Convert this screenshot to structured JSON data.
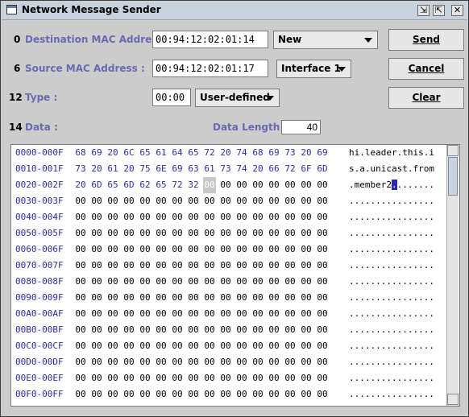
{
  "window": {
    "title": "Network Message Sender"
  },
  "fields": {
    "dest": {
      "num": "0",
      "label": "Destination MAC Address :",
      "value": "00:94:12:02:01:14",
      "combo": "New"
    },
    "src": {
      "num": "6",
      "label": "Source MAC Address :",
      "value": "00:94:12:02:01:17",
      "combo": "Interface 1"
    },
    "type": {
      "num": "12",
      "label": "Type :",
      "value": "00:00",
      "combo": "User-defined"
    },
    "data": {
      "num": "14",
      "label": "Data :",
      "length_label": "Data Length :",
      "length_value": "40"
    }
  },
  "buttons": {
    "send": "Send",
    "cancel": "Cancel",
    "clear": "Clear"
  },
  "hex": {
    "rows": [
      {
        "offset": "0000-000F",
        "bytes": [
          "68",
          "69",
          "20",
          "6C",
          "65",
          "61",
          "64",
          "65",
          "72",
          "20",
          "74",
          "68",
          "69",
          "73",
          "20",
          "69"
        ],
        "ascii": "hi.leader.this.i"
      },
      {
        "offset": "0010-001F",
        "bytes": [
          "73",
          "20",
          "61",
          "20",
          "75",
          "6E",
          "69",
          "63",
          "61",
          "73",
          "74",
          "20",
          "66",
          "72",
          "6F",
          "6D"
        ],
        "ascii": "s.a.unicast.from"
      },
      {
        "offset": "0020-002F",
        "bytes": [
          "20",
          "6D",
          "65",
          "6D",
          "62",
          "65",
          "72",
          "32",
          "00",
          "00",
          "00",
          "00",
          "00",
          "00",
          "00",
          "00"
        ],
        "ascii": ".member2........"
      },
      {
        "offset": "0030-003F",
        "bytes": [
          "00",
          "00",
          "00",
          "00",
          "00",
          "00",
          "00",
          "00",
          "00",
          "00",
          "00",
          "00",
          "00",
          "00",
          "00",
          "00"
        ],
        "ascii": "................"
      },
      {
        "offset": "0040-004F",
        "bytes": [
          "00",
          "00",
          "00",
          "00",
          "00",
          "00",
          "00",
          "00",
          "00",
          "00",
          "00",
          "00",
          "00",
          "00",
          "00",
          "00"
        ],
        "ascii": "................"
      },
      {
        "offset": "0050-005F",
        "bytes": [
          "00",
          "00",
          "00",
          "00",
          "00",
          "00",
          "00",
          "00",
          "00",
          "00",
          "00",
          "00",
          "00",
          "00",
          "00",
          "00"
        ],
        "ascii": "................"
      },
      {
        "offset": "0060-006F",
        "bytes": [
          "00",
          "00",
          "00",
          "00",
          "00",
          "00",
          "00",
          "00",
          "00",
          "00",
          "00",
          "00",
          "00",
          "00",
          "00",
          "00"
        ],
        "ascii": "................"
      },
      {
        "offset": "0070-007F",
        "bytes": [
          "00",
          "00",
          "00",
          "00",
          "00",
          "00",
          "00",
          "00",
          "00",
          "00",
          "00",
          "00",
          "00",
          "00",
          "00",
          "00"
        ],
        "ascii": "................"
      },
      {
        "offset": "0080-008F",
        "bytes": [
          "00",
          "00",
          "00",
          "00",
          "00",
          "00",
          "00",
          "00",
          "00",
          "00",
          "00",
          "00",
          "00",
          "00",
          "00",
          "00"
        ],
        "ascii": "................"
      },
      {
        "offset": "0090-009F",
        "bytes": [
          "00",
          "00",
          "00",
          "00",
          "00",
          "00",
          "00",
          "00",
          "00",
          "00",
          "00",
          "00",
          "00",
          "00",
          "00",
          "00"
        ],
        "ascii": "................"
      },
      {
        "offset": "00A0-00AF",
        "bytes": [
          "00",
          "00",
          "00",
          "00",
          "00",
          "00",
          "00",
          "00",
          "00",
          "00",
          "00",
          "00",
          "00",
          "00",
          "00",
          "00"
        ],
        "ascii": "................"
      },
      {
        "offset": "00B0-00BF",
        "bytes": [
          "00",
          "00",
          "00",
          "00",
          "00",
          "00",
          "00",
          "00",
          "00",
          "00",
          "00",
          "00",
          "00",
          "00",
          "00",
          "00"
        ],
        "ascii": "................"
      },
      {
        "offset": "00C0-00CF",
        "bytes": [
          "00",
          "00",
          "00",
          "00",
          "00",
          "00",
          "00",
          "00",
          "00",
          "00",
          "00",
          "00",
          "00",
          "00",
          "00",
          "00"
        ],
        "ascii": "................"
      },
      {
        "offset": "00D0-00DF",
        "bytes": [
          "00",
          "00",
          "00",
          "00",
          "00",
          "00",
          "00",
          "00",
          "00",
          "00",
          "00",
          "00",
          "00",
          "00",
          "00",
          "00"
        ],
        "ascii": "................"
      },
      {
        "offset": "00E0-00EF",
        "bytes": [
          "00",
          "00",
          "00",
          "00",
          "00",
          "00",
          "00",
          "00",
          "00",
          "00",
          "00",
          "00",
          "00",
          "00",
          "00",
          "00"
        ],
        "ascii": "................"
      },
      {
        "offset": "00F0-00FF",
        "bytes": [
          "00",
          "00",
          "00",
          "00",
          "00",
          "00",
          "00",
          "00",
          "00",
          "00",
          "00",
          "00",
          "00",
          "00",
          "00",
          "00"
        ],
        "ascii": "................"
      }
    ],
    "cursor": {
      "row": 2,
      "col": 8
    }
  },
  "colors": {
    "label": "#6a6ab0",
    "hex_value": "#2a2ab0",
    "cursor_ascii": "#2a2ab0"
  }
}
